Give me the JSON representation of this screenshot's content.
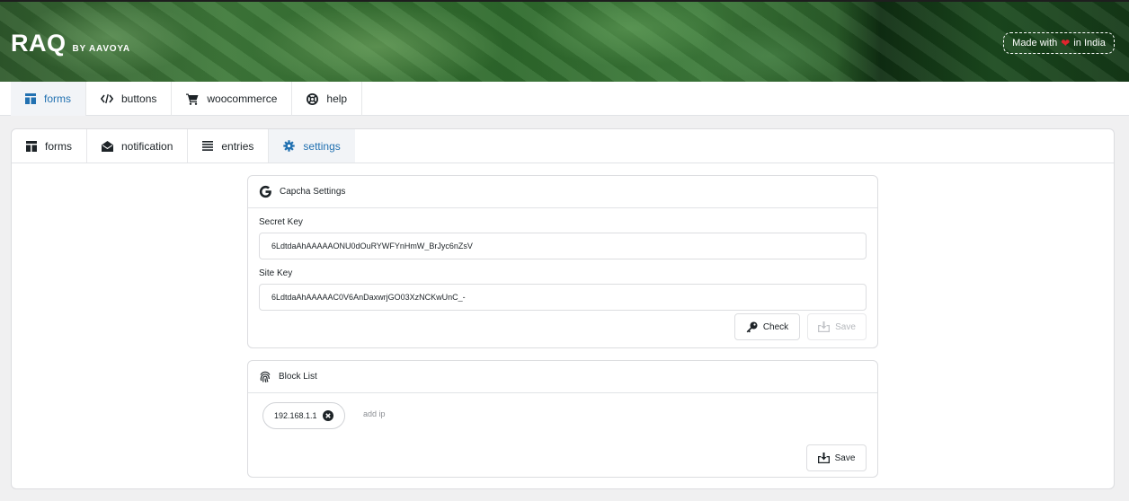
{
  "brand": {
    "name": "RAQ",
    "by": "BY AAVOYA"
  },
  "made_with": {
    "prefix": "Made with",
    "suffix": "in India"
  },
  "topnav": [
    {
      "label": "forms",
      "icon": "layout-icon",
      "active": true
    },
    {
      "label": "buttons",
      "icon": "code-icon",
      "active": false
    },
    {
      "label": "woocommerce",
      "icon": "cart-icon",
      "active": false
    },
    {
      "label": "help",
      "icon": "help-icon",
      "active": false
    }
  ],
  "subnav": [
    {
      "label": "forms",
      "icon": "layout-icon",
      "active": false
    },
    {
      "label": "notification",
      "icon": "envelope-open-icon",
      "active": false
    },
    {
      "label": "entries",
      "icon": "list-icon",
      "active": false
    },
    {
      "label": "settings",
      "icon": "gear-icon",
      "active": true
    }
  ],
  "captcha": {
    "title": "Capcha Settings",
    "secret_label": "Secret Key",
    "secret_value": "6LdtdaAhAAAAAONU0dOuRYWFYnHmW_BrJyc6nZsV",
    "site_label": "Site Key",
    "site_value": "6LdtdaAhAAAAAC0V6AnDaxwrjGO03XzNCKwUnC_-",
    "check_label": "Check",
    "save_label": "Save"
  },
  "blocklist": {
    "title": "Block List",
    "ips": [
      "192.168.1.1"
    ],
    "add_placeholder": "add ip",
    "save_label": "Save"
  },
  "colors": {
    "accent": "#2271b1",
    "heart": "#e0242d"
  }
}
